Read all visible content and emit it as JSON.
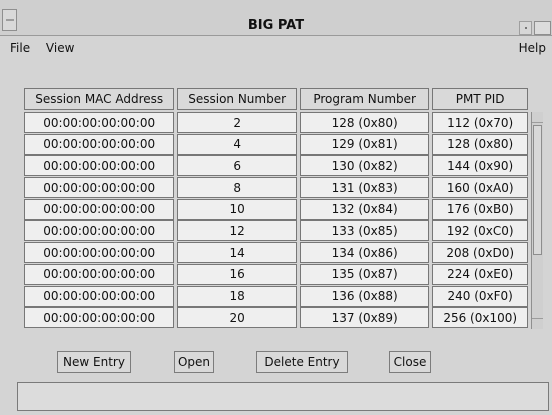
{
  "window": {
    "title": "BIG PAT"
  },
  "menu": {
    "file": "File",
    "view": "View",
    "help": "Help"
  },
  "table": {
    "headers": [
      "Session MAC Address",
      "Session Number",
      "Program Number",
      "PMT PID"
    ],
    "rows": [
      [
        "00:00:00:00:00:00",
        "2",
        "128 (0x80)",
        "112 (0x70)"
      ],
      [
        "00:00:00:00:00:00",
        "4",
        "129 (0x81)",
        "128 (0x80)"
      ],
      [
        "00:00:00:00:00:00",
        "6",
        "130 (0x82)",
        "144 (0x90)"
      ],
      [
        "00:00:00:00:00:00",
        "8",
        "131 (0x83)",
        "160 (0xA0)"
      ],
      [
        "00:00:00:00:00:00",
        "10",
        "132 (0x84)",
        "176 (0xB0)"
      ],
      [
        "00:00:00:00:00:00",
        "12",
        "133 (0x85)",
        "192 (0xC0)"
      ],
      [
        "00:00:00:00:00:00",
        "14",
        "134 (0x86)",
        "208 (0xD0)"
      ],
      [
        "00:00:00:00:00:00",
        "16",
        "135 (0x87)",
        "224 (0xE0)"
      ],
      [
        "00:00:00:00:00:00",
        "18",
        "136 (0x88)",
        "240 (0xF0)"
      ],
      [
        "00:00:00:00:00:00",
        "20",
        "137 (0x89)",
        "256 (0x100)"
      ]
    ]
  },
  "buttons": {
    "new_entry": "New Entry",
    "open": "Open",
    "delete_entry": "Delete Entry",
    "close": "Close"
  }
}
